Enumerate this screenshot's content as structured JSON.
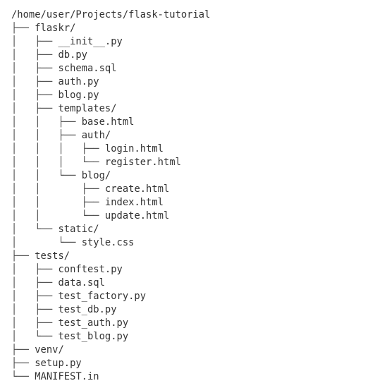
{
  "tree": {
    "lines": [
      {
        "prefix": "",
        "name": "/home/user/Projects/flask-tutorial",
        "kind": "root"
      },
      {
        "prefix": "├── ",
        "name": "flaskr/",
        "kind": "dir"
      },
      {
        "prefix": "│   ├── ",
        "name": "__init__.py",
        "kind": "file"
      },
      {
        "prefix": "│   ├── ",
        "name": "db.py",
        "kind": "file"
      },
      {
        "prefix": "│   ├── ",
        "name": "schema.sql",
        "kind": "file"
      },
      {
        "prefix": "│   ├── ",
        "name": "auth.py",
        "kind": "file"
      },
      {
        "prefix": "│   ├── ",
        "name": "blog.py",
        "kind": "file"
      },
      {
        "prefix": "│   ├── ",
        "name": "templates/",
        "kind": "dir"
      },
      {
        "prefix": "│   │   ├── ",
        "name": "base.html",
        "kind": "file"
      },
      {
        "prefix": "│   │   ├── ",
        "name": "auth/",
        "kind": "dir"
      },
      {
        "prefix": "│   │   │   ├── ",
        "name": "login.html",
        "kind": "file"
      },
      {
        "prefix": "│   │   │   └── ",
        "name": "register.html",
        "kind": "file"
      },
      {
        "prefix": "│   │   └── ",
        "name": "blog/",
        "kind": "dir"
      },
      {
        "prefix": "│   │       ├── ",
        "name": "create.html",
        "kind": "file"
      },
      {
        "prefix": "│   │       ├── ",
        "name": "index.html",
        "kind": "file"
      },
      {
        "prefix": "│   │       └── ",
        "name": "update.html",
        "kind": "file"
      },
      {
        "prefix": "│   └── ",
        "name": "static/",
        "kind": "dir"
      },
      {
        "prefix": "│       └── ",
        "name": "style.css",
        "kind": "file"
      },
      {
        "prefix": "├── ",
        "name": "tests/",
        "kind": "dir"
      },
      {
        "prefix": "│   ├── ",
        "name": "conftest.py",
        "kind": "file"
      },
      {
        "prefix": "│   ├── ",
        "name": "data.sql",
        "kind": "file"
      },
      {
        "prefix": "│   ├── ",
        "name": "test_factory.py",
        "kind": "file"
      },
      {
        "prefix": "│   ├── ",
        "name": "test_db.py",
        "kind": "file"
      },
      {
        "prefix": "│   ├── ",
        "name": "test_auth.py",
        "kind": "file"
      },
      {
        "prefix": "│   └── ",
        "name": "test_blog.py",
        "kind": "file"
      },
      {
        "prefix": "├── ",
        "name": "venv/",
        "kind": "dir"
      },
      {
        "prefix": "├── ",
        "name": "setup.py",
        "kind": "file"
      },
      {
        "prefix": "└── ",
        "name": "MANIFEST.in",
        "kind": "file"
      }
    ]
  }
}
